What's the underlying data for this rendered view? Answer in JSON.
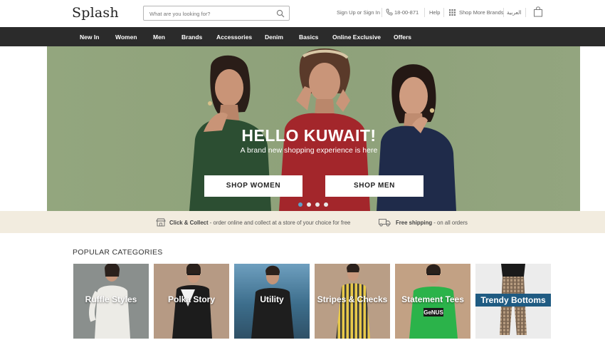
{
  "header": {
    "logo": "Splash",
    "search_placeholder": "What are you looking for?",
    "signin": "Sign Up or Sign In",
    "phone": "18-00-871",
    "help": "Help",
    "more_brands": "Shop More Brands",
    "language": "العربية"
  },
  "nav": {
    "items": [
      "New In",
      "Women",
      "Men",
      "Brands",
      "Accessories",
      "Denim",
      "Basics",
      "Online Exclusive",
      "Offers"
    ]
  },
  "hero": {
    "title": "HELLO KUWAIT!",
    "subtitle": "A brand new shopping experience is here",
    "buttons": [
      "SHOP WOMEN",
      "SHOP MEN"
    ],
    "slide_count": 4,
    "active_slide": 1
  },
  "promo": {
    "collect_bold": "Click & Collect",
    "collect_rest": " - order online and collect at a store of your choice for free",
    "shipping_bold": "Free shipping",
    "shipping_rest": " - on all orders"
  },
  "categories": {
    "heading": "POPULAR CATEGORIES",
    "items": [
      {
        "label": "Ruffle Styles",
        "bg": "#7b8180"
      },
      {
        "label": "Polka Story",
        "bg": "#b69a84"
      },
      {
        "label": "Utility",
        "bg": "#3b6f8a"
      },
      {
        "label": "Stripes & Checks",
        "bg": "#b79c84"
      },
      {
        "label": "Statement Tees",
        "bg": "#c2a184"
      },
      {
        "label": "Trendy Bottoms",
        "bg": "#ececec"
      }
    ]
  },
  "colors": {
    "nav_bg": "#2b2b2b",
    "hero_bg": "#8fa37b",
    "promo_bg": "#f2ecdf",
    "dot_active": "#5da0c8",
    "band_label": "#1f5b82"
  }
}
